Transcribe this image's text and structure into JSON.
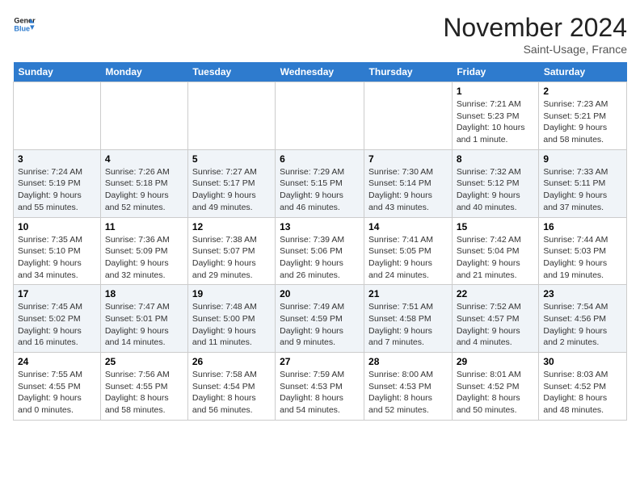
{
  "logo": {
    "text_general": "General",
    "text_blue": "Blue"
  },
  "header": {
    "month_title": "November 2024",
    "subtitle": "Saint-Usage, France"
  },
  "weekdays": [
    "Sunday",
    "Monday",
    "Tuesday",
    "Wednesday",
    "Thursday",
    "Friday",
    "Saturday"
  ],
  "weeks": [
    [
      {
        "day": "",
        "detail": ""
      },
      {
        "day": "",
        "detail": ""
      },
      {
        "day": "",
        "detail": ""
      },
      {
        "day": "",
        "detail": ""
      },
      {
        "day": "",
        "detail": ""
      },
      {
        "day": "1",
        "detail": "Sunrise: 7:21 AM\nSunset: 5:23 PM\nDaylight: 10 hours and 1 minute."
      },
      {
        "day": "2",
        "detail": "Sunrise: 7:23 AM\nSunset: 5:21 PM\nDaylight: 9 hours and 58 minutes."
      }
    ],
    [
      {
        "day": "3",
        "detail": "Sunrise: 7:24 AM\nSunset: 5:19 PM\nDaylight: 9 hours and 55 minutes."
      },
      {
        "day": "4",
        "detail": "Sunrise: 7:26 AM\nSunset: 5:18 PM\nDaylight: 9 hours and 52 minutes."
      },
      {
        "day": "5",
        "detail": "Sunrise: 7:27 AM\nSunset: 5:17 PM\nDaylight: 9 hours and 49 minutes."
      },
      {
        "day": "6",
        "detail": "Sunrise: 7:29 AM\nSunset: 5:15 PM\nDaylight: 9 hours and 46 minutes."
      },
      {
        "day": "7",
        "detail": "Sunrise: 7:30 AM\nSunset: 5:14 PM\nDaylight: 9 hours and 43 minutes."
      },
      {
        "day": "8",
        "detail": "Sunrise: 7:32 AM\nSunset: 5:12 PM\nDaylight: 9 hours and 40 minutes."
      },
      {
        "day": "9",
        "detail": "Sunrise: 7:33 AM\nSunset: 5:11 PM\nDaylight: 9 hours and 37 minutes."
      }
    ],
    [
      {
        "day": "10",
        "detail": "Sunrise: 7:35 AM\nSunset: 5:10 PM\nDaylight: 9 hours and 34 minutes."
      },
      {
        "day": "11",
        "detail": "Sunrise: 7:36 AM\nSunset: 5:09 PM\nDaylight: 9 hours and 32 minutes."
      },
      {
        "day": "12",
        "detail": "Sunrise: 7:38 AM\nSunset: 5:07 PM\nDaylight: 9 hours and 29 minutes."
      },
      {
        "day": "13",
        "detail": "Sunrise: 7:39 AM\nSunset: 5:06 PM\nDaylight: 9 hours and 26 minutes."
      },
      {
        "day": "14",
        "detail": "Sunrise: 7:41 AM\nSunset: 5:05 PM\nDaylight: 9 hours and 24 minutes."
      },
      {
        "day": "15",
        "detail": "Sunrise: 7:42 AM\nSunset: 5:04 PM\nDaylight: 9 hours and 21 minutes."
      },
      {
        "day": "16",
        "detail": "Sunrise: 7:44 AM\nSunset: 5:03 PM\nDaylight: 9 hours and 19 minutes."
      }
    ],
    [
      {
        "day": "17",
        "detail": "Sunrise: 7:45 AM\nSunset: 5:02 PM\nDaylight: 9 hours and 16 minutes."
      },
      {
        "day": "18",
        "detail": "Sunrise: 7:47 AM\nSunset: 5:01 PM\nDaylight: 9 hours and 14 minutes."
      },
      {
        "day": "19",
        "detail": "Sunrise: 7:48 AM\nSunset: 5:00 PM\nDaylight: 9 hours and 11 minutes."
      },
      {
        "day": "20",
        "detail": "Sunrise: 7:49 AM\nSunset: 4:59 PM\nDaylight: 9 hours and 9 minutes."
      },
      {
        "day": "21",
        "detail": "Sunrise: 7:51 AM\nSunset: 4:58 PM\nDaylight: 9 hours and 7 minutes."
      },
      {
        "day": "22",
        "detail": "Sunrise: 7:52 AM\nSunset: 4:57 PM\nDaylight: 9 hours and 4 minutes."
      },
      {
        "day": "23",
        "detail": "Sunrise: 7:54 AM\nSunset: 4:56 PM\nDaylight: 9 hours and 2 minutes."
      }
    ],
    [
      {
        "day": "24",
        "detail": "Sunrise: 7:55 AM\nSunset: 4:55 PM\nDaylight: 9 hours and 0 minutes."
      },
      {
        "day": "25",
        "detail": "Sunrise: 7:56 AM\nSunset: 4:55 PM\nDaylight: 8 hours and 58 minutes."
      },
      {
        "day": "26",
        "detail": "Sunrise: 7:58 AM\nSunset: 4:54 PM\nDaylight: 8 hours and 56 minutes."
      },
      {
        "day": "27",
        "detail": "Sunrise: 7:59 AM\nSunset: 4:53 PM\nDaylight: 8 hours and 54 minutes."
      },
      {
        "day": "28",
        "detail": "Sunrise: 8:00 AM\nSunset: 4:53 PM\nDaylight: 8 hours and 52 minutes."
      },
      {
        "day": "29",
        "detail": "Sunrise: 8:01 AM\nSunset: 4:52 PM\nDaylight: 8 hours and 50 minutes."
      },
      {
        "day": "30",
        "detail": "Sunrise: 8:03 AM\nSunset: 4:52 PM\nDaylight: 8 hours and 48 minutes."
      }
    ]
  ]
}
